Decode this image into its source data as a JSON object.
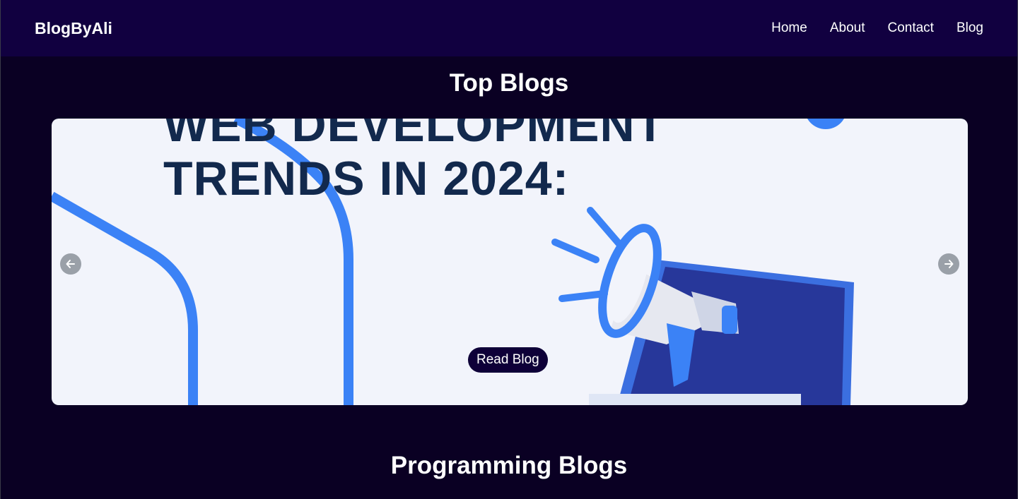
{
  "navbar": {
    "brand": "BlogByAli",
    "links": [
      "Home",
      "About",
      "Contact",
      "Blog"
    ]
  },
  "sections": {
    "top_blogs_title": "Top Blogs",
    "programming_blogs_title": "Programming Blogs"
  },
  "carousel": {
    "slide_heading_line1": "WEB DEVELOPMENT",
    "slide_heading_line2": "TRENDS IN 2024:",
    "read_button_label": "Read Blog",
    "prev_icon": "arrow-left-icon",
    "next_icon": "arrow-right-icon"
  },
  "colors": {
    "page_bg": "#0a0023",
    "navbar_bg": "#110040",
    "slide_bg": "#f2f4fb",
    "accent_blue": "#3b82f6",
    "heading_navy": "#12294d"
  }
}
